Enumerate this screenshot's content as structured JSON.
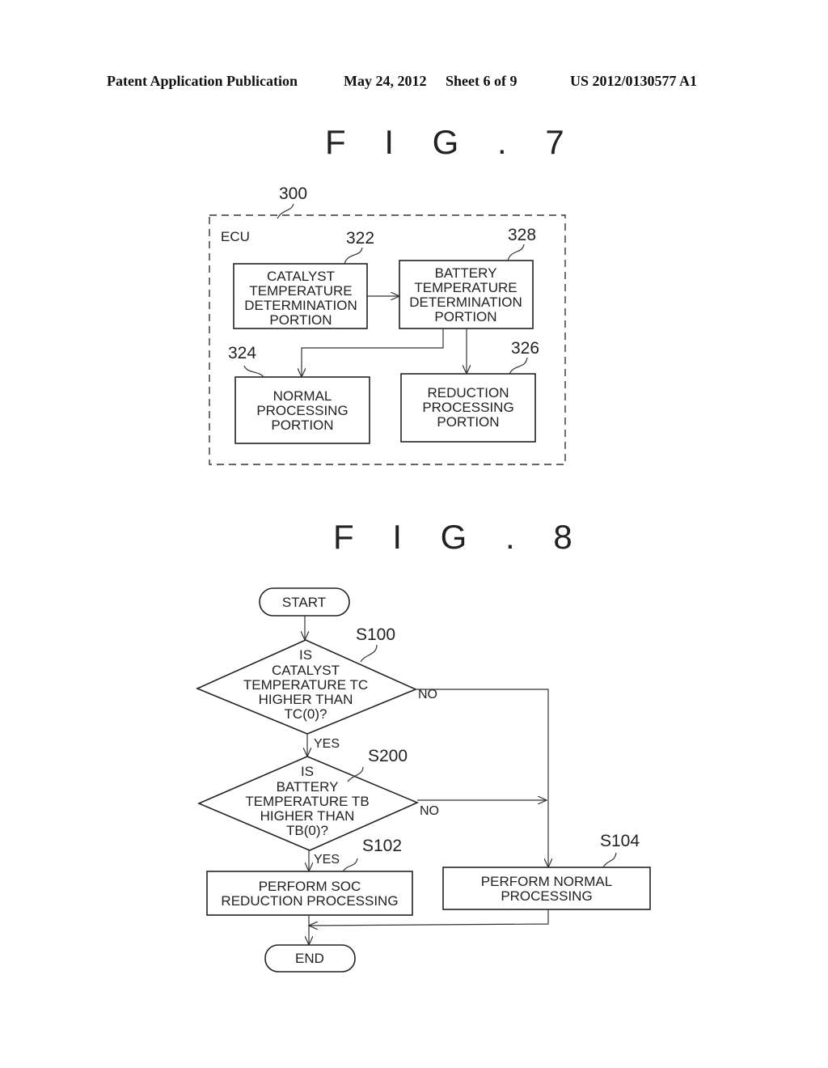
{
  "header": {
    "publication_type": "Patent Application Publication",
    "date": "May 24, 2012",
    "sheet": "Sheet 6 of 9",
    "publication_number": "US 2012/0130577 A1"
  },
  "fig7": {
    "title": "F I G . 7",
    "container": {
      "ref": "300",
      "label": "ECU"
    },
    "blocks": [
      {
        "ref": "322",
        "lines": [
          "CATALYST",
          "TEMPERATURE",
          "DETERMINATION",
          "PORTION"
        ]
      },
      {
        "ref": "328",
        "lines": [
          "BATTERY",
          "TEMPERATURE",
          "DETERMINATION",
          "PORTION"
        ]
      },
      {
        "ref": "324",
        "lines": [
          "NORMAL",
          "PROCESSING",
          "PORTION"
        ]
      },
      {
        "ref": "326",
        "lines": [
          "REDUCTION",
          "PROCESSING",
          "PORTION"
        ]
      }
    ]
  },
  "fig8": {
    "title": "F I G . 8",
    "start": "START",
    "end": "END",
    "s100": {
      "ref": "S100",
      "lines": [
        "IS",
        "CATALYST",
        "TEMPERATURE TC",
        "HIGHER THAN",
        "TC(0)?"
      ],
      "yes": "YES",
      "no": "NO"
    },
    "s200": {
      "ref": "S200",
      "lines": [
        "IS",
        "BATTERY",
        "TEMPERATURE TB",
        "HIGHER THAN",
        "TB(0)?"
      ],
      "yes": "YES",
      "no": "NO"
    },
    "s102": {
      "ref": "S102",
      "lines": [
        "PERFORM SOC",
        "REDUCTION PROCESSING"
      ]
    },
    "s104": {
      "ref": "S104",
      "lines": [
        "PERFORM NORMAL",
        "PROCESSING"
      ]
    }
  }
}
